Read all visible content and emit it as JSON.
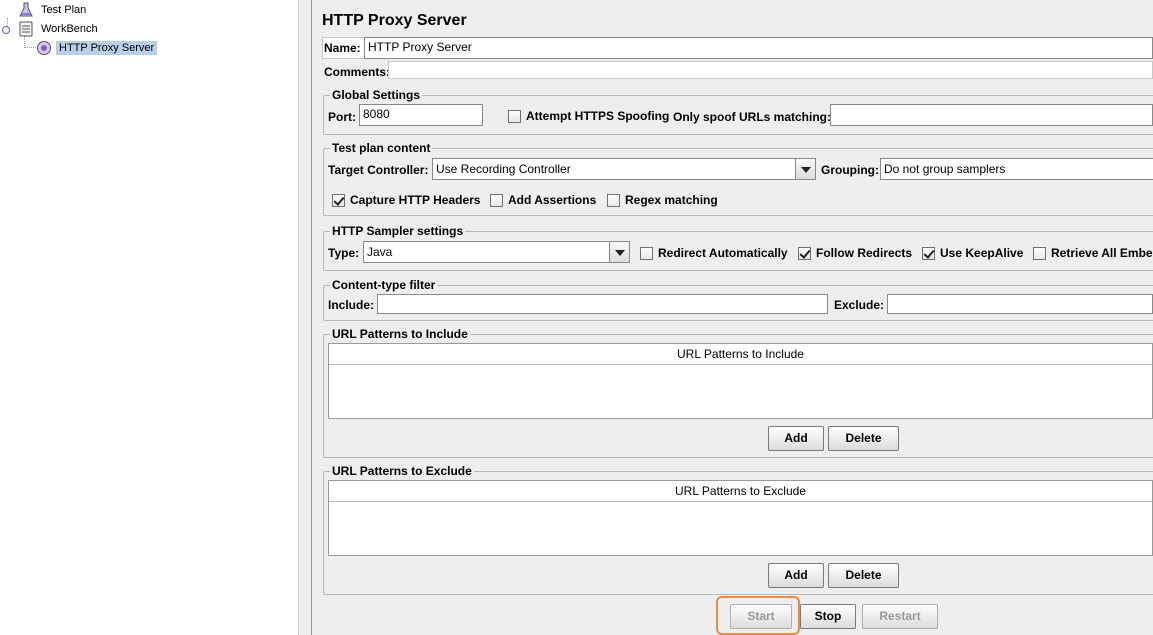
{
  "tree": {
    "items": [
      {
        "label": "Test Plan",
        "icon": "test-plan-icon"
      },
      {
        "label": "WorkBench",
        "icon": "workbench-icon"
      },
      {
        "label": "HTTP Proxy Server",
        "icon": "proxy-server-icon",
        "selected": true
      }
    ]
  },
  "panel": {
    "title": "HTTP Proxy Server",
    "name_label": "Name:",
    "name_value": "HTTP Proxy Server",
    "comments_label": "Comments:",
    "comments_value": ""
  },
  "global": {
    "title": "Global Settings",
    "port_label": "Port:",
    "port_value": "8080",
    "https_spoof_label": "Attempt HTTPS Spoofing",
    "https_spoof_checked": false,
    "spoof_urls_label": "Only spoof URLs matching:",
    "spoof_urls_value": ""
  },
  "content": {
    "title": "Test plan content",
    "target_label": "Target Controller:",
    "target_value": "Use Recording Controller",
    "grouping_label": "Grouping:",
    "grouping_value": "Do not group samplers",
    "capture_headers_label": "Capture HTTP Headers",
    "capture_headers_checked": true,
    "add_assertions_label": "Add Assertions",
    "add_assertions_checked": false,
    "regex_label": "Regex matching",
    "regex_checked": false
  },
  "sampler": {
    "title": "HTTP Sampler settings",
    "type_label": "Type:",
    "type_value": "Java",
    "redirect_label": "Redirect Automatically",
    "redirect_checked": false,
    "follow_label": "Follow Redirects",
    "follow_checked": true,
    "keepalive_label": "Use KeepAlive",
    "keepalive_checked": true,
    "retrieve_label": "Retrieve All Embed"
  },
  "filter": {
    "title": "Content-type filter",
    "include_label": "Include:",
    "include_value": "",
    "exclude_label": "Exclude:",
    "exclude_value": ""
  },
  "include_patterns": {
    "title": "URL Patterns to Include",
    "column": "URL Patterns to Include",
    "add": "Add",
    "delete": "Delete"
  },
  "exclude_patterns": {
    "title": "URL Patterns to Exclude",
    "column": "URL Patterns to Exclude",
    "add": "Add",
    "delete": "Delete"
  },
  "controls": {
    "start": "Start",
    "stop": "Stop",
    "restart": "Restart"
  },
  "colors": {
    "selection": "#b8cfe5",
    "highlight": "#f08a3c",
    "panel_bg": "#eeeeee"
  }
}
